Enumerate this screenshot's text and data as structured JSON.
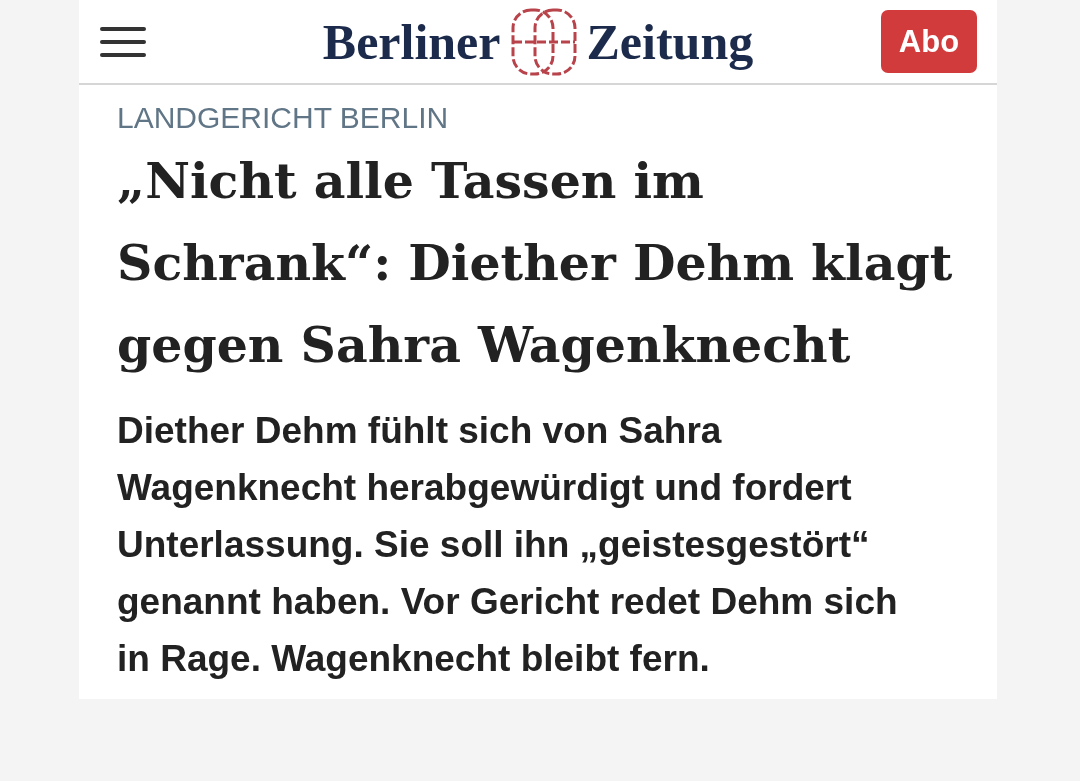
{
  "header": {
    "logo": {
      "word_left": "Berliner",
      "word_right": "Zeitung"
    },
    "subscribe_button": {
      "label": "Abo"
    }
  },
  "article": {
    "kicker": "LANDGERICHT BERLIN",
    "headline": "„Nicht alle Tassen im Schrank“: Diether Dehm klagt gegen Sahra Wagenknecht",
    "teaser": "Diether Dehm fühlt sich von Sahra Wagenknecht herabgewürdigt und fordert Unterlassung. Sie soll ihn „geistesgestört“ genannt haben. Vor Gericht redet Dehm sich in Rage. Wagenknecht bleibt fern."
  }
}
